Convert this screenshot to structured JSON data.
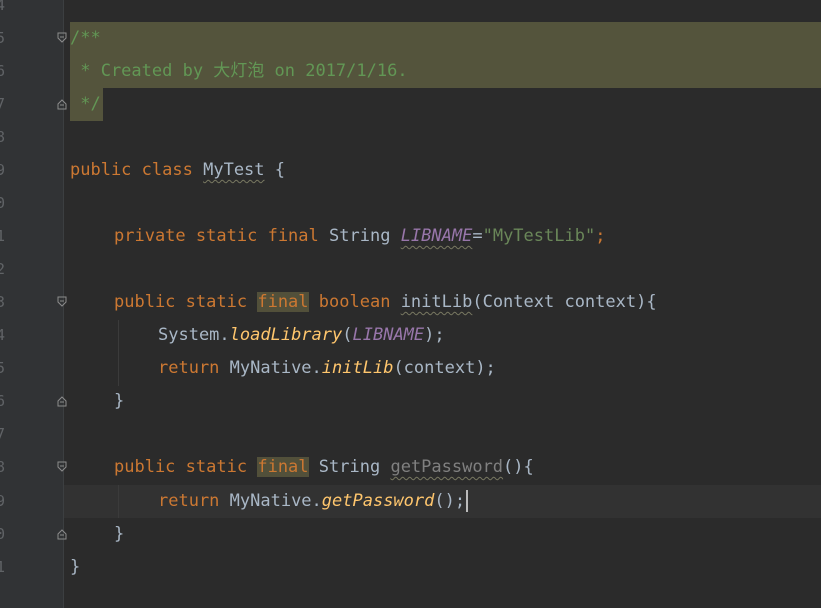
{
  "editor": {
    "line_numbers": [
      "4",
      "5",
      "6",
      "7",
      "8",
      "9",
      "0",
      "1",
      "2",
      "3",
      "4",
      "5",
      "6",
      "7",
      "8",
      "9",
      "0",
      "1"
    ],
    "comment": {
      "open": "/**",
      "body": " * Created by 大灯泡 on 2017/1/16.",
      "close": " */"
    },
    "class_decl": {
      "kw1": "public",
      "kw2": "class",
      "name": "MyTest",
      "brace": " {"
    },
    "field": {
      "kw1": "private",
      "kw2": "static",
      "kw3": "final",
      "type": "String",
      "name": "LIBNAME",
      "eq": "=",
      "value": "\"MyTestLib\"",
      "semi": ";"
    },
    "method1": {
      "kw1": "public",
      "kw2": "static",
      "kw3": "final",
      "type": "boolean",
      "name": "initLib",
      "params": "(Context context){",
      "line1_obj": "System.",
      "line1_call": "loadLibrary",
      "line1_open": "(",
      "line1_arg": "LIBNAME",
      "line1_close": ");",
      "line2_kw": "return",
      "line2_obj": " MyNative.",
      "line2_call": "initLib",
      "line2_rest": "(context);",
      "close": "}"
    },
    "method2": {
      "kw1": "public",
      "kw2": "static",
      "kw3": "final",
      "type": "String",
      "name": "getPassword",
      "params": "(){",
      "line1_kw": "return",
      "line1_obj": " MyNative.",
      "line1_call": "getPassword",
      "line1_rest": "();",
      "close": "}"
    },
    "class_close": "}"
  },
  "colors": {
    "background": "#2b2b2b",
    "gutter": "#313335",
    "keyword": "#cc7832",
    "comment": "#629755",
    "string": "#6a8759",
    "constant": "#9876aa",
    "method_call": "#ffc66d",
    "text": "#a9b7c6"
  }
}
